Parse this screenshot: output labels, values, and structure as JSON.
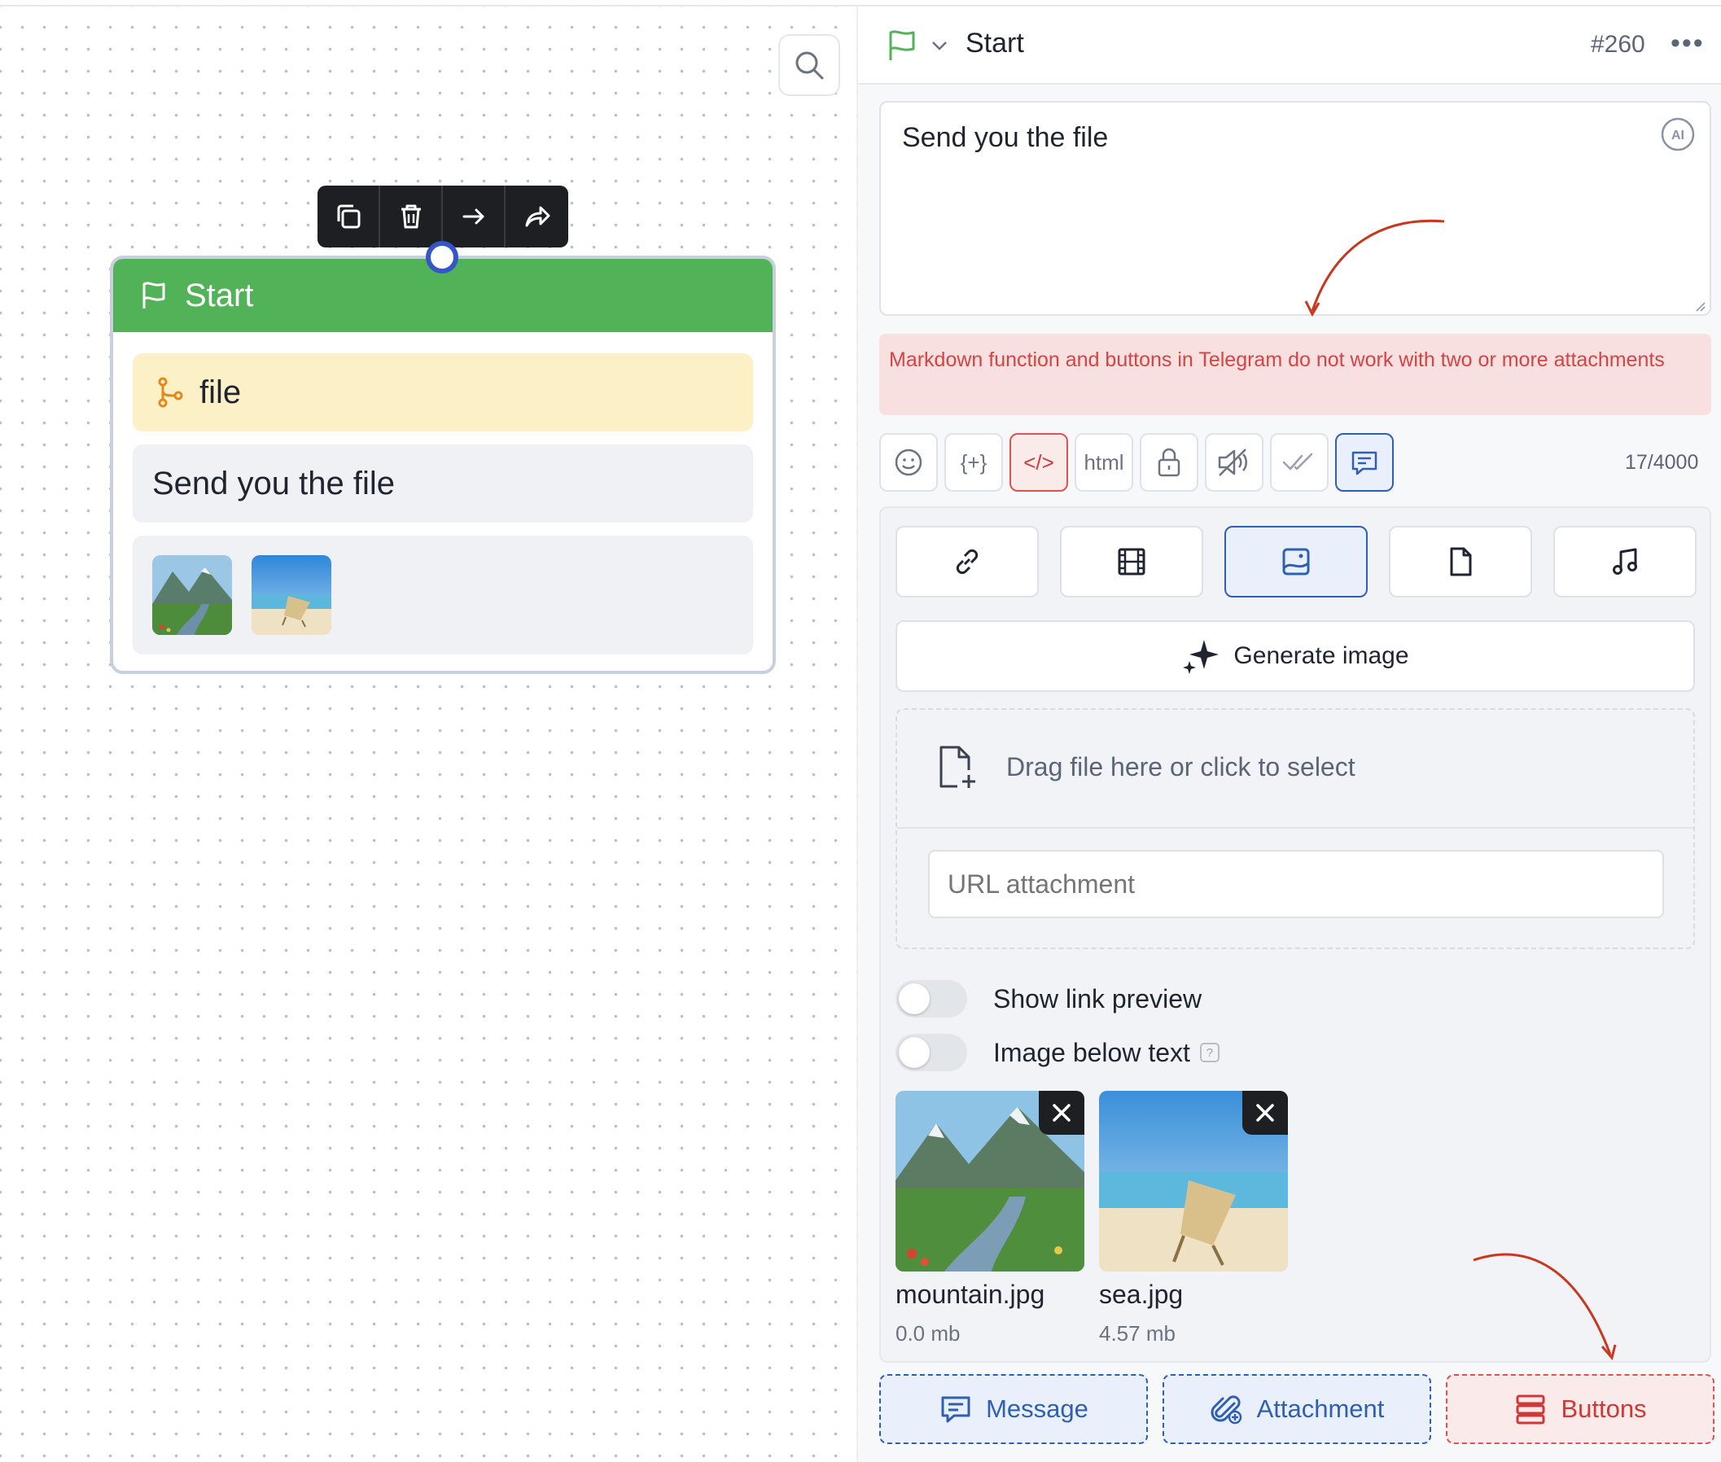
{
  "canvas": {
    "toolbar": {
      "icons": [
        "copy-icon",
        "trash-icon",
        "arrow-right-icon",
        "share-icon"
      ]
    },
    "node": {
      "title": "Start",
      "variable": "file",
      "text": "Send you the file",
      "thumbnails": [
        "mountain",
        "sea"
      ]
    }
  },
  "panel": {
    "header": {
      "title": "Start",
      "id": "#260",
      "more": "•••"
    },
    "message_text": "Send you the file",
    "ai_label": "AI",
    "warning": "Markdown function and buttons in Telegram do not work with two or more attachments",
    "format_buttons": {
      "emoji": "☺",
      "variable": "{+}",
      "code": "</>",
      "html": "html",
      "lock": "lock-icon",
      "mute": "mute-icon",
      "read": "double-check-icon",
      "message": "message-icon"
    },
    "counter": "17/4000",
    "attachment_types": [
      "link",
      "video",
      "image",
      "document",
      "audio"
    ],
    "active_type": "image",
    "generate_label": "Generate image",
    "drop_label": "Drag file here or click to select",
    "url_placeholder": "URL attachment",
    "toggles": {
      "link_preview": {
        "label": "Show link preview",
        "on": false
      },
      "image_below": {
        "label": "Image below text",
        "on": false,
        "help": "?"
      }
    },
    "files": [
      {
        "name": "mountain.jpg",
        "size": "0.0 mb"
      },
      {
        "name": "sea.jpg",
        "size": "4.57 mb"
      }
    ],
    "bottom_buttons": {
      "message": "Message",
      "attachment": "Attachment",
      "buttons": "Buttons"
    }
  },
  "colors": {
    "node_header": "#52b257",
    "variable_bg": "#fcf0c6",
    "accent_blue": "#2f5fb3",
    "warning_text": "#d34545",
    "warning_bg": "#f8dfe0",
    "annotation_arrow": "#c8381f"
  }
}
